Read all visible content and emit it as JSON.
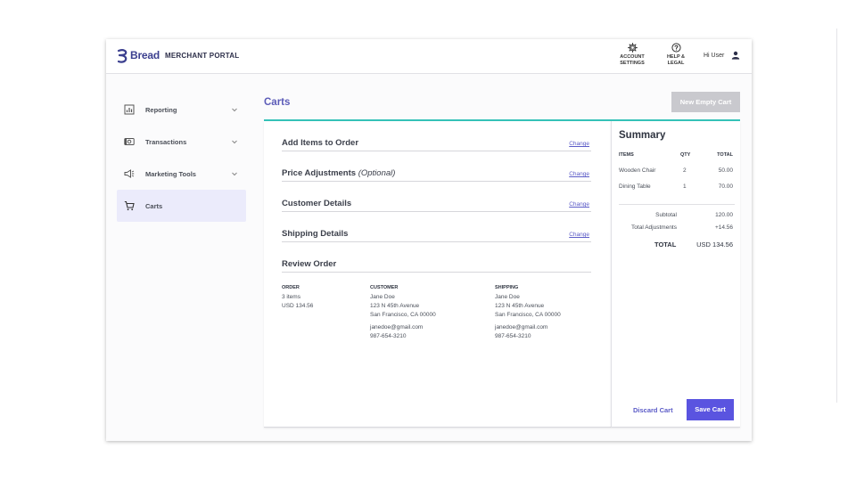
{
  "header": {
    "brand": "Bread",
    "portal": "MERCHANT PORTAL",
    "account_settings": [
      "ACCOUNT",
      "SETTINGS"
    ],
    "help_legal": [
      "HELP &",
      "LEGAL"
    ],
    "greeting": "Hi User"
  },
  "sidebar": {
    "items": [
      {
        "label": "Reporting",
        "icon": "chart-icon",
        "has_chevron": true
      },
      {
        "label": "Transactions",
        "icon": "money-icon",
        "has_chevron": true
      },
      {
        "label": "Marketing Tools",
        "icon": "megaphone-icon",
        "has_chevron": true
      },
      {
        "label": "Carts",
        "icon": "cart-icon",
        "has_chevron": false,
        "active": true
      }
    ]
  },
  "page": {
    "title": "Carts",
    "new_cart_label": "New Empty Cart"
  },
  "sections": [
    {
      "title": "Add Items to Order",
      "optional": "",
      "change": "Change"
    },
    {
      "title": "Price Adjustments",
      "optional": "(Optional)",
      "change": "Change"
    },
    {
      "title": "Customer Details",
      "optional": "",
      "change": "Change"
    },
    {
      "title": "Shipping Details",
      "optional": "",
      "change": "Change"
    },
    {
      "title": "Review Order",
      "optional": "",
      "change": ""
    }
  ],
  "review": {
    "order": {
      "header": "ORDER",
      "items": "3 items",
      "total": "USD 134.56"
    },
    "customer": {
      "header": "CUSTOMER",
      "name": "Jane Doe",
      "street": "123 N 45th Avenue",
      "city": "San Francisco, CA 00000",
      "email": "janedoe@gmail.com",
      "phone": "987-654-3210"
    },
    "shipping": {
      "header": "SHIPPING",
      "name": "Jane Doe",
      "street": "123 N 45th Avenue",
      "city": "San Francisco, CA 00000",
      "email": "janedoe@gmail.com",
      "phone": "987-654-3210"
    }
  },
  "summary": {
    "title": "Summary",
    "columns": [
      "ITEMS",
      "QTY",
      "TOTAL"
    ],
    "rows": [
      {
        "item": "Wooden Chair",
        "qty": "2",
        "total": "50.00"
      },
      {
        "item": "Dining Table",
        "qty": "1",
        "total": "70.00"
      }
    ],
    "subtotal_label": "Subtotal",
    "subtotal_value": "120.00",
    "adjustments_label": "Total Adjustments",
    "adjustments_value": "+14.56",
    "total_label": "TOTAL",
    "total_value": "USD 134.56",
    "discard_label": "Discard Cart",
    "save_label": "Save Cart"
  },
  "colors": {
    "accent": "#5a54e0",
    "title": "#5b5bb8",
    "teal": "#35c2b8",
    "active_bg": "#ebebfb",
    "disabled_btn": "#c9c9ce"
  }
}
